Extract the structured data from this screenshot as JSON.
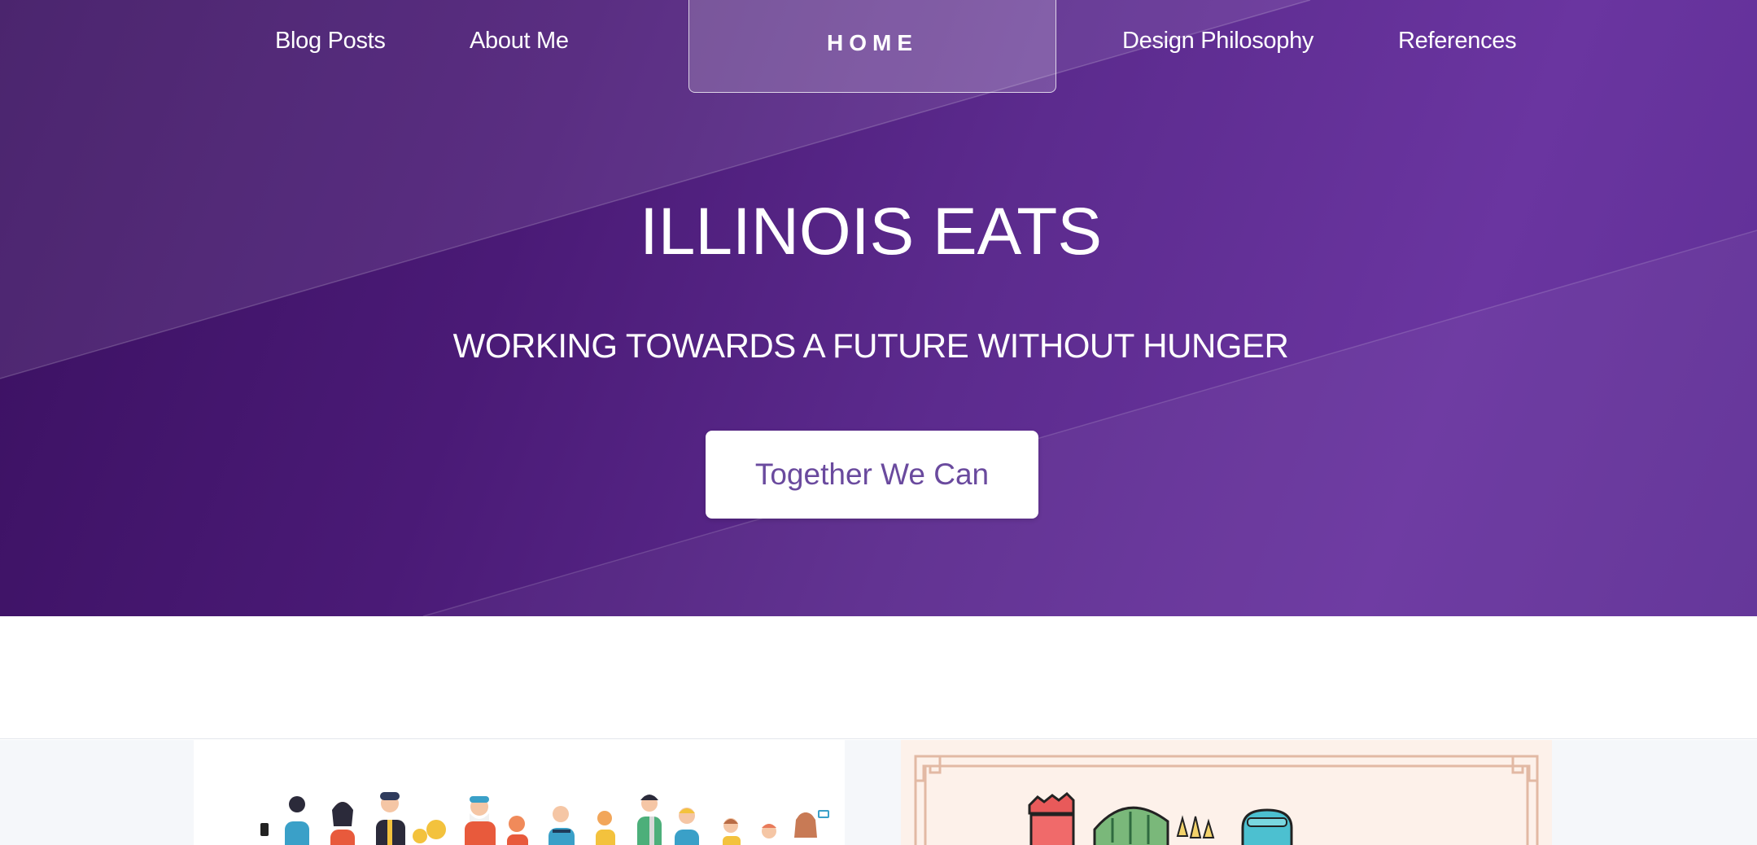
{
  "nav": {
    "blog_posts": "Blog Posts",
    "about_me": "About Me",
    "home": "HOME",
    "design_philosophy": "Design Philosophy",
    "references": "References"
  },
  "hero": {
    "title": "ILLINOIS EATS",
    "subtitle": "WORKING TOWARDS A FUTURE WITHOUT HUNGER",
    "cta_label": "Together We Can"
  },
  "colors": {
    "hero_dark": "#3a1060",
    "hero_light": "#6a35a0",
    "cta_text": "#6a4a9e",
    "section_bg": "#f5f7fa",
    "card_right_bg": "#fdf1ea"
  },
  "cards": [
    {
      "illustration": "people-crowd-illustration"
    },
    {
      "illustration": "food-groceries-illustration"
    }
  ]
}
